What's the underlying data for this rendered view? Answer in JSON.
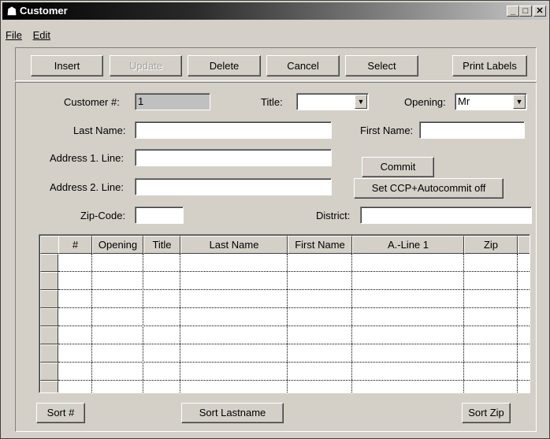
{
  "window": {
    "title": "Customer"
  },
  "menu": {
    "file": "File",
    "edit": "Edit"
  },
  "toolbar": {
    "insert": "Insert",
    "update": "Update",
    "delete": "Delete",
    "cancel": "Cancel",
    "select": "Select",
    "print_labels": "Print Labels"
  },
  "form": {
    "customer_no_label": "Customer #:",
    "customer_no_value": "1",
    "title_label": "Title:",
    "title_value": "",
    "opening_label": "Opening:",
    "opening_value": "Mr",
    "last_name_label": "Last Name:",
    "last_name_value": "",
    "first_name_label": "First Name:",
    "first_name_value": "",
    "address1_label": "Address 1. Line:",
    "address1_value": "",
    "address2_label": "Address 2. Line:",
    "address2_value": "",
    "zip_label": "Zip-Code:",
    "zip_value": "",
    "district_label": "District:",
    "district_value": "",
    "commit": "Commit",
    "set_ccp": "Set CCP+Autocommit off"
  },
  "grid": {
    "columns": [
      "#",
      "Opening",
      "Title",
      "Last Name",
      "First Name",
      "A.-Line 1",
      "Zip"
    ],
    "rows": [
      [],
      [],
      [],
      [],
      [],
      [],
      [],
      []
    ]
  },
  "sort": {
    "sort_no": "Sort #",
    "sort_lastname": "Sort Lastname",
    "sort_zip": "Sort Zip"
  },
  "icons": {
    "app": "customer-app-icon",
    "minimize": "minimize-icon",
    "maximize": "maximize-icon",
    "close": "close-icon"
  }
}
